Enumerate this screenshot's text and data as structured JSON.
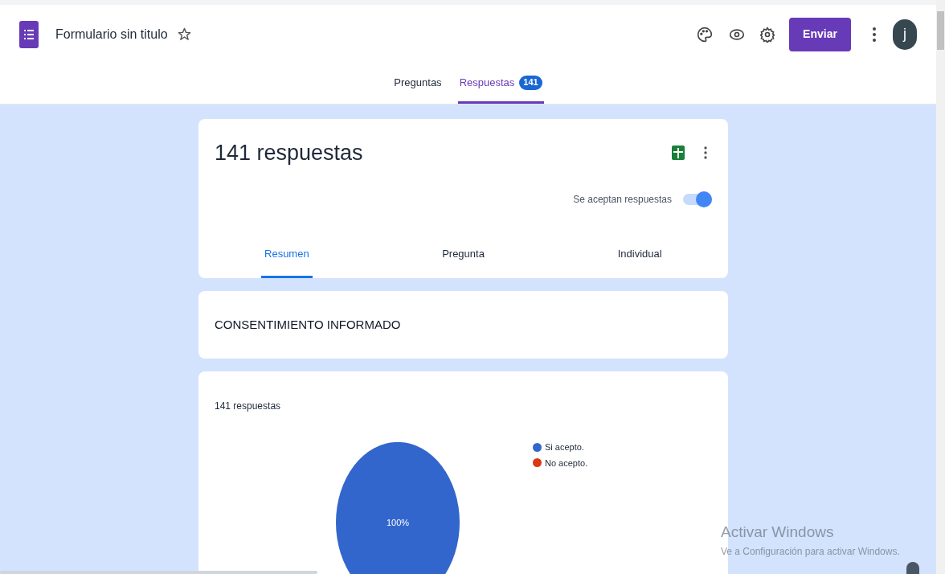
{
  "header": {
    "title": "Formulario sin titulo",
    "starred": false,
    "send_button": "Enviar",
    "avatar": "j"
  },
  "tabs": [
    {
      "label": "Preguntas",
      "selected": false
    },
    {
      "label": "Respuestas",
      "selected": true,
      "badge": "141"
    }
  ],
  "summary_card": {
    "title": "141 respuestas",
    "accepting_label": "Se aceptan respuestas",
    "accepting": true,
    "tabs": [
      {
        "label": "Resumen",
        "selected": true
      },
      {
        "label": "Pregunta",
        "selected": false
      },
      {
        "label": "Individual",
        "selected": false
      }
    ]
  },
  "section_card": {
    "title": "CONSENTIMIENTO INFORMADO"
  },
  "question_card": {
    "count": "141 respuestas",
    "chart_data": {
      "type": "pie",
      "categories": [
        "Si acepto.",
        "No acepto."
      ],
      "series": [
        {
          "values": [
            100,
            0
          ]
        }
      ],
      "colors": [
        "#3366cc",
        "#dc3912"
      ],
      "value_labels": [
        "100%",
        null
      ]
    }
  },
  "windows_notice": {
    "title": "Activar Windows",
    "text": "Ve a Configuración para activar Windows."
  }
}
